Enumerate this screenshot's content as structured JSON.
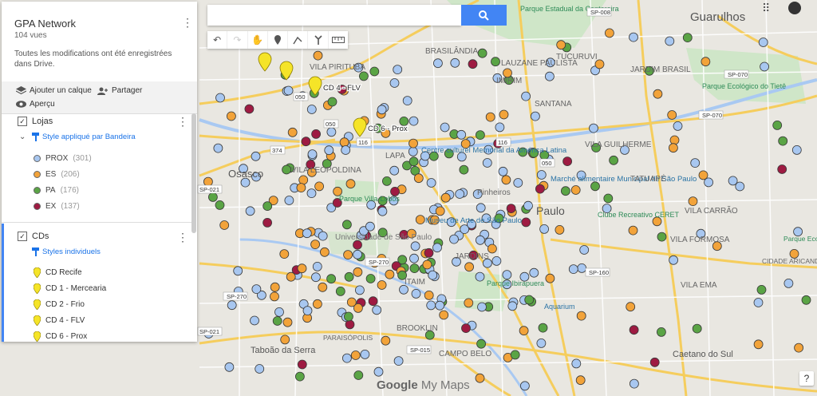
{
  "panel": {
    "title": "GPA Network",
    "views": "104 vues",
    "saved_msg": "Toutes les modifications ont été enregistrées dans Drive.",
    "actions": {
      "add_layer": "Ajouter un calque",
      "share": "Partager",
      "preview": "Aperçu"
    },
    "layers": [
      {
        "name": "Lojas",
        "style_label": "Style appliqué par Bandeira",
        "legend": [
          {
            "label": "PROX",
            "count": "(301)",
            "color": "#a8c7f0"
          },
          {
            "label": "ES",
            "count": "(206)",
            "color": "#f2a33a"
          },
          {
            "label": "PA",
            "count": "(176)",
            "color": "#5aa445"
          },
          {
            "label": "EX",
            "count": "(137)",
            "color": "#9e1b42"
          }
        ]
      },
      {
        "name": "CDs",
        "style_label": "Styles individuels",
        "items": [
          "CD Recife",
          "CD 1 - Mercearia",
          "CD 2 - Frio",
          "CD 4 - FLV",
          "CD 6 - Prox"
        ]
      }
    ]
  },
  "map": {
    "place_labels": [
      "Guarulhos",
      "VILA PIRITUBA",
      "LAUZANE PAULISTA",
      "TUCURUVI",
      "JARDIM BRASIL",
      "IMIRIM",
      "SANTANA",
      "VILA GUILHERME",
      "Centre culturel Memorial da América Latina",
      "Marché alimentaire Municipal de São Paulo",
      "TATUAPÉ",
      "VILA CARRÃO",
      "Paulo",
      "Clube Recreativo CERET",
      "VILA FORMOSA",
      "Osasco",
      "VILA LEOPOLDINA",
      "Parque Villa-Lobos",
      "Museu de Arte de São Paulo",
      "Universidade de São Paulo",
      "JARDINS",
      "ITAIM",
      "Parque Ibirapuera",
      "VILA EMA",
      "Aquarium",
      "BROOKLIN",
      "Taboão da Serra",
      "CAMPO BELO",
      "Caetano do Sul",
      "PARAISÓPOLIS",
      "CIDADE ARICANDUVA",
      "Parque Ecológico do Tietê",
      "Parque Estadual da Cantareira",
      "BRASILÂNDIA",
      "LAPA",
      "Pinheiros",
      "Parque Ecológico Tietê"
    ],
    "pin_labels": [
      "CD 4 - FLV",
      "CD 6 - Prox"
    ],
    "road_labels": [
      "SP-008",
      "SP-070",
      "SP-070",
      "050",
      "050",
      "374",
      "116",
      "116",
      "050",
      "SP-270",
      "SP-160",
      "SP-015",
      "SP-021",
      "SP-021",
      "SP-270"
    ],
    "brand": {
      "google": "Google",
      "my_maps": "My Maps"
    }
  },
  "colors": {
    "prox": "#a8c7f0",
    "es": "#f2a33a",
    "pa": "#5aa445",
    "ex": "#9e1b42",
    "pin": "#f5e428",
    "search_btn": "#4285f4"
  }
}
